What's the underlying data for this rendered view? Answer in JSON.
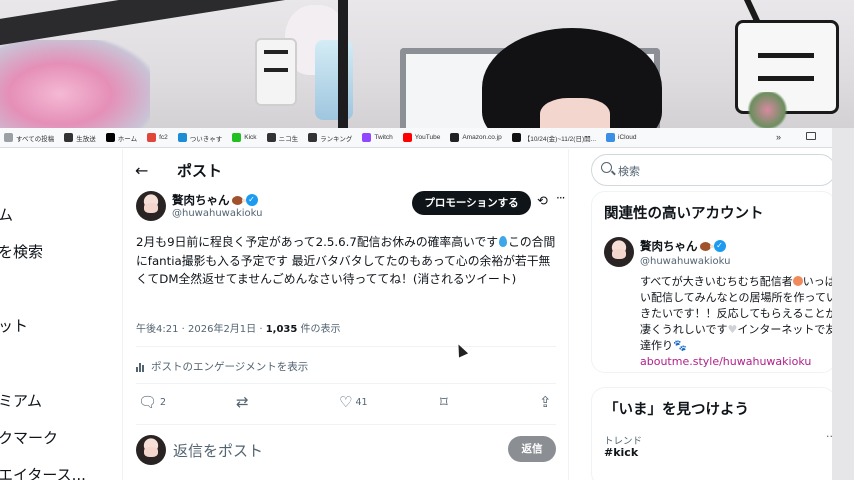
{
  "bookmarks": [
    {
      "label": "すべての投稿",
      "color": "#9aa0a6"
    },
    {
      "label": "生放送",
      "color": "#333333"
    },
    {
      "label": "ホーム",
      "color": "#000000"
    },
    {
      "label": "fc2",
      "color": "#e0463a"
    },
    {
      "label": "ついきゃす",
      "color": "#1c8cd6"
    },
    {
      "label": "Kick",
      "color": "#20c020"
    },
    {
      "label": "ニコ生",
      "color": "#333333"
    },
    {
      "label": "ランキング",
      "color": "#333333"
    },
    {
      "label": "Twitch",
      "color": "#9146ff"
    },
    {
      "label": "YouTube",
      "color": "#ff0000"
    },
    {
      "label": "Amazon.co.jp",
      "color": "#222222"
    },
    {
      "label": "【10/24(金)~11/2(日)開...",
      "color": "#111111"
    },
    {
      "label": "iCloud",
      "color": "#3a8ee6"
    }
  ],
  "bookmarks_more": "»",
  "leftnav": [
    "ム",
    "を検索",
    "ット",
    "ミアム",
    "クマーク",
    "エイタース..."
  ],
  "post_header": {
    "back": "←",
    "title": "ポスト"
  },
  "author": {
    "name": "贅肉ちゃん",
    "handle": "@huwahuwakioku",
    "promo_button": "プロモーションする",
    "more": "···"
  },
  "tweet": {
    "text_1": "2月も9日前に程良く予定があって2.5.6.7配信お休みの確率高いです",
    "text_2": "この合間にfantia撮影も入る予定です 最近バタバタしてたのもあって心の余裕が若干無くてDM全然返せてませんごめんなさい待っててね！(消されるツイート)",
    "time": "午後4:21 · 2026年2月1日 · ",
    "views_count": "1,035",
    "views_label": " 件の表示",
    "engagement_label": "ポストのエンゲージメントを表示"
  },
  "actions": {
    "replies": "2",
    "likes": "41"
  },
  "reply": {
    "placeholder": "返信をポスト",
    "button": "返信"
  },
  "sidebar": {
    "search_placeholder": "検索",
    "relevant_title": "関連性の高いアカウント",
    "rec_name": "贅肉ちゃん",
    "rec_handle": "@huwahuwakioku",
    "rec_bio_1": "すべてが大きいむちむち配信者",
    "rec_bio_2": "いっぱい配信してみんなとの居場所を作っていきたいです！！反応してもらえることが凄くうれしいです",
    "rec_bio_3": "インターネットで友達作り",
    "rec_link": "aboutme.style/huwahuwakioku",
    "trend_title": "「いま」を見つけよう",
    "trend_label": "トレンド",
    "trend_name": "#kick",
    "trend_more": "··"
  },
  "colors": {
    "accent": "#1d9bf0",
    "text": "#0f1419",
    "muted": "#536471",
    "link": "#b0218a"
  }
}
